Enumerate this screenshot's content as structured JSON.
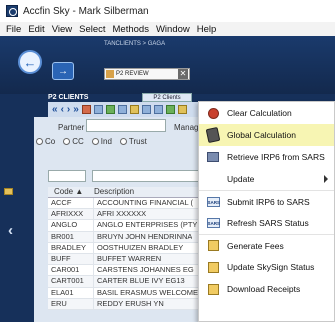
{
  "window": {
    "title": "Accfin Sky - Mark Silberman"
  },
  "menubar": {
    "items": [
      "File",
      "Edit",
      "View",
      "Select",
      "Methods",
      "Window",
      "Help"
    ]
  },
  "header": {
    "breadcrumb": "TANCLIENTS > GAGA",
    "review_label": "P2 REVIEW",
    "close_glyph": "✕"
  },
  "panel": {
    "title": "P2 CLIENTS",
    "tab_label": "P2 Clients",
    "nav_arrows": [
      "«",
      "‹",
      "›",
      "»"
    ]
  },
  "filters": {
    "partner_label": "Partner",
    "manager_label": "Manage",
    "radios": [
      "Co",
      "CC",
      "Ind",
      "Trust"
    ]
  },
  "grid": {
    "columns": [
      "Code",
      "Description"
    ],
    "sort_glyph": "▲",
    "rows": [
      [
        "ACCF",
        "ACCOUNTING FINANCIAL ("
      ],
      [
        "AFRIXXX",
        "AFRI XXXXXX"
      ],
      [
        "ANGLO",
        "ANGLO ENTERPRISES (PTY"
      ],
      [
        "BR001",
        "BRUYN JOHN HENDRINNA"
      ],
      [
        "BRADLEY",
        "OOSTHUIZEN BRADLEY"
      ],
      [
        "BUFF",
        "BUFFET WARREN"
      ],
      [
        "CAR001",
        "CARSTENS JOHANNES EG"
      ],
      [
        "CART001",
        "CARTER BLUE IVY EG13"
      ],
      [
        "ELA01",
        "BASIL ERASMUS WELCOME"
      ],
      [
        "ERU",
        "REDDY ERUSH YN"
      ]
    ]
  },
  "context_menu": {
    "items": [
      {
        "label": "Clear Calculation",
        "icon": "clear-icon"
      },
      {
        "label": "Global Calculation",
        "icon": "calculator-icon",
        "highlighted": true
      },
      {
        "label": "Retrieve IRP6 from SARS",
        "icon": "card-icon"
      },
      {
        "label": "Update",
        "icon": "none",
        "submenu": true
      },
      {
        "label": "Submit IRP6 to SARS",
        "icon": "sars-icon"
      },
      {
        "label": "Refresh SARS Status",
        "icon": "sars-icon"
      },
      {
        "label": "Generate Fees",
        "icon": "fees-icon"
      },
      {
        "label": "Update SkySign Status",
        "icon": "skysign-icon"
      },
      {
        "label": "Download Receipts",
        "icon": "receipt-icon"
      }
    ],
    "sars_icon_text": "SARS"
  },
  "colors": {
    "app_background": "#16305a",
    "highlight": "#f7f5b3"
  }
}
